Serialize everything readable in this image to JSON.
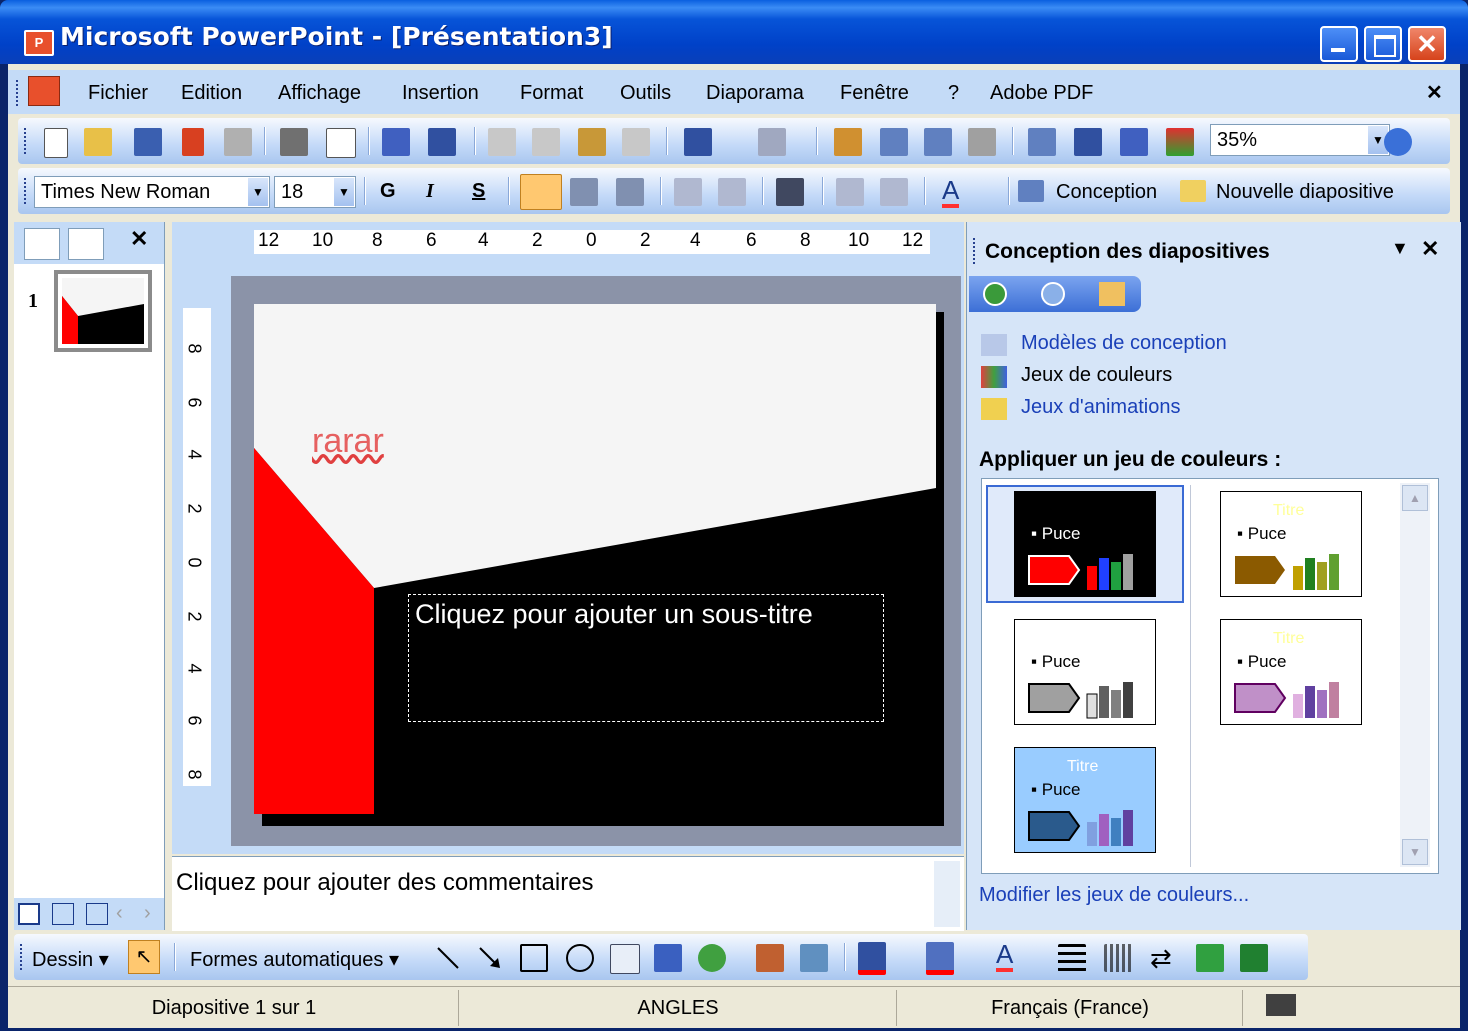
{
  "window": {
    "title": "Microsoft PowerPoint - [Présentation3]"
  },
  "menubar": {
    "items": [
      "Fichier",
      "Edition",
      "Affichage",
      "Insertion",
      "Format",
      "Outils",
      "Diaporama",
      "Fenêtre",
      "?",
      "Adobe PDF"
    ],
    "close_glyph": "✕"
  },
  "standard_toolbar": {
    "zoom_value": "35%"
  },
  "format_toolbar": {
    "font_name": "Times New Roman",
    "font_size": "18",
    "bold_label": "G",
    "italic_label": "I",
    "shadow_label": "S",
    "font_color_label": "A",
    "design_label": "Conception",
    "new_slide_label": "Nouvelle diapositive"
  },
  "outline_pane": {
    "slide_number": "1",
    "close_glyph": "✕"
  },
  "rulers": {
    "horizontal": [
      "12",
      "10",
      "8",
      "6",
      "4",
      "2",
      "0",
      "2",
      "4",
      "6",
      "8",
      "10",
      "12"
    ],
    "vertical": [
      "8",
      "6",
      "4",
      "2",
      "0",
      "2",
      "4",
      "6",
      "8"
    ]
  },
  "slide": {
    "title_text": "rarar",
    "subtitle_placeholder": "Cliquez pour ajouter un sous-titre"
  },
  "notes": {
    "placeholder": "Cliquez pour ajouter des commentaires"
  },
  "task_pane": {
    "title": "Conception des diapositives",
    "links": [
      "Modèles de conception",
      "Jeux de couleurs",
      "Jeux d'animations"
    ],
    "section_heading": "Appliquer un jeu de couleurs :",
    "swatch_bullet": "Puce",
    "swatch_title": "Titre",
    "footer_link": "Modifier les jeux de couleurs...",
    "color_schemes": [
      {
        "bg": "#000000",
        "text": "#ffffff",
        "accent": "#ff0000"
      },
      {
        "bg": "#ffffff",
        "text": "#000000",
        "accent": "#8b5a00"
      },
      {
        "bg": "#ffffff",
        "text": "#000000",
        "accent": "#a0a0a0"
      },
      {
        "bg": "#ffffff",
        "text": "#000000",
        "accent": "#c090c8"
      },
      {
        "bg": "#99ccff",
        "text": "#000000",
        "accent": "#2a5a8c"
      }
    ]
  },
  "drawing_toolbar": {
    "draw_label": "Dessin",
    "autoshapes_label": "Formes automatiques"
  },
  "status_bar": {
    "slide_info": "Diapositive 1 sur 1",
    "design_name": "ANGLES",
    "language": "Français (France)"
  }
}
